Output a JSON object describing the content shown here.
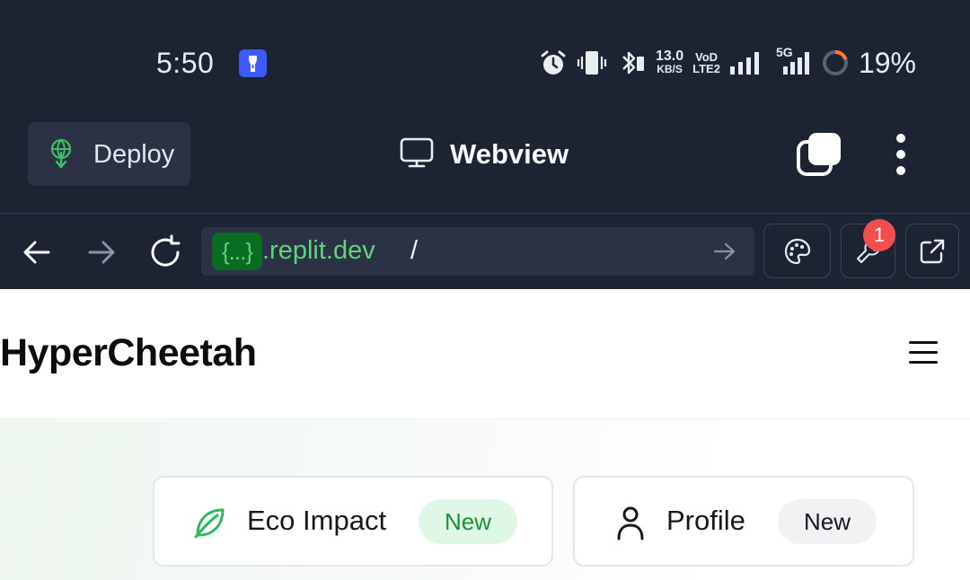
{
  "status_bar": {
    "time": "5:50",
    "net_speed": "13.0",
    "net_speed_unit": "KB/S",
    "volte_top": "VoD",
    "volte_bottom": "LTE2",
    "network": "5G",
    "battery": "19%",
    "icons": [
      "torch-icon",
      "alarm-icon",
      "vibrate-icon",
      "bluetooth-icon",
      "signal-icon",
      "battery-ring-icon"
    ]
  },
  "appbar": {
    "deploy_label": "Deploy",
    "title": "Webview"
  },
  "urlbar": {
    "badge": "{...}",
    "domain": ".replit.dev",
    "path": "/",
    "notification_count": "1"
  },
  "site": {
    "title": "HyperCheetah",
    "cards": [
      {
        "label": "Eco Impact",
        "pill": "New",
        "icon": "leaf-icon"
      },
      {
        "label": "Profile",
        "pill": "New",
        "icon": "user-icon"
      }
    ]
  },
  "colors": {
    "chrome_bg": "#1c2333",
    "chrome_surface": "#2b3245",
    "url_green": "#5fd47a",
    "badge_red": "#f24e4e",
    "eco_pill_bg": "#dff7e5",
    "eco_pill_text": "#1f8f3a"
  }
}
